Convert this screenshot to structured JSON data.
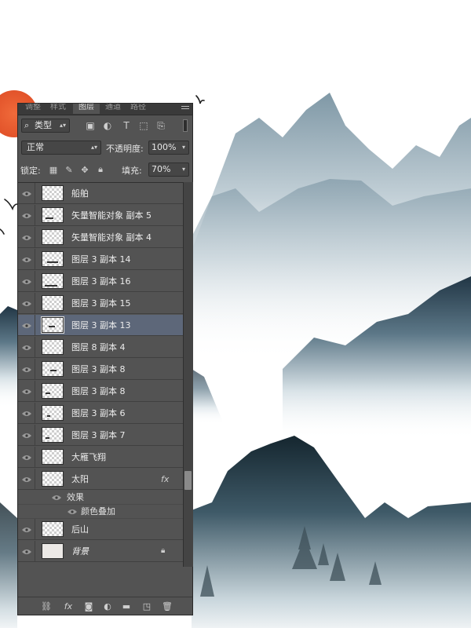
{
  "panel": {
    "tabs": [
      "调整",
      "样式",
      "图层",
      "通道",
      "路径"
    ],
    "active_tab": 2,
    "menu_icon": "panel-menu-icon",
    "filter": {
      "label": "类型",
      "icon": "search-icon"
    },
    "filter_icons": [
      "image-filter-icon",
      "adjustment-filter-icon",
      "type-filter-icon",
      "shape-filter-icon",
      "smart-object-filter-icon"
    ],
    "blend_mode": "正常",
    "opacity_label": "不透明度:",
    "opacity_value": "100%",
    "lock_label": "锁定:",
    "lock_icons": [
      "lock-transparent-icon",
      "lock-paint-icon",
      "lock-move-icon",
      "lock-all-icon"
    ],
    "fill_label": "填充:",
    "fill_value": "70%",
    "layers": [
      {
        "name": "船舶",
        "visible": true,
        "selected": false
      },
      {
        "name": "矢量智能对象 副本 5",
        "visible": true,
        "selected": false
      },
      {
        "name": "矢量智能对象 副本 4",
        "visible": true,
        "selected": false
      },
      {
        "name": "图层 3 副本 14",
        "visible": true,
        "selected": false
      },
      {
        "name": "图层 3 副本 16",
        "visible": true,
        "selected": false
      },
      {
        "name": "图层 3 副本 15",
        "visible": true,
        "selected": false
      },
      {
        "name": "图层 3 副本 13",
        "visible": true,
        "selected": true
      },
      {
        "name": "图层 8 副本 4",
        "visible": true,
        "selected": false
      },
      {
        "name": "图层 3 副本 8",
        "visible": true,
        "selected": false
      },
      {
        "name": "图层 3 副本 8",
        "visible": true,
        "selected": false
      },
      {
        "name": "图层 3 副本 6",
        "visible": true,
        "selected": false
      },
      {
        "name": "图层 3 副本 7",
        "visible": true,
        "selected": false
      },
      {
        "name": "大雁飞翔",
        "visible": true,
        "selected": false
      },
      {
        "name": "太阳",
        "visible": true,
        "selected": false,
        "fx": "fx"
      },
      {
        "name": "后山",
        "visible": true,
        "selected": false
      },
      {
        "name": "背景",
        "visible": true,
        "selected": false,
        "locked": true
      }
    ],
    "effects_label": "效果",
    "effect_item": "颜色叠加",
    "bottom_icons": [
      "link-layers-icon",
      "fx-icon",
      "add-mask-icon",
      "adjustment-layer-icon",
      "new-group-icon",
      "new-layer-icon",
      "delete-layer-icon"
    ],
    "fx_glyph": "fx"
  }
}
